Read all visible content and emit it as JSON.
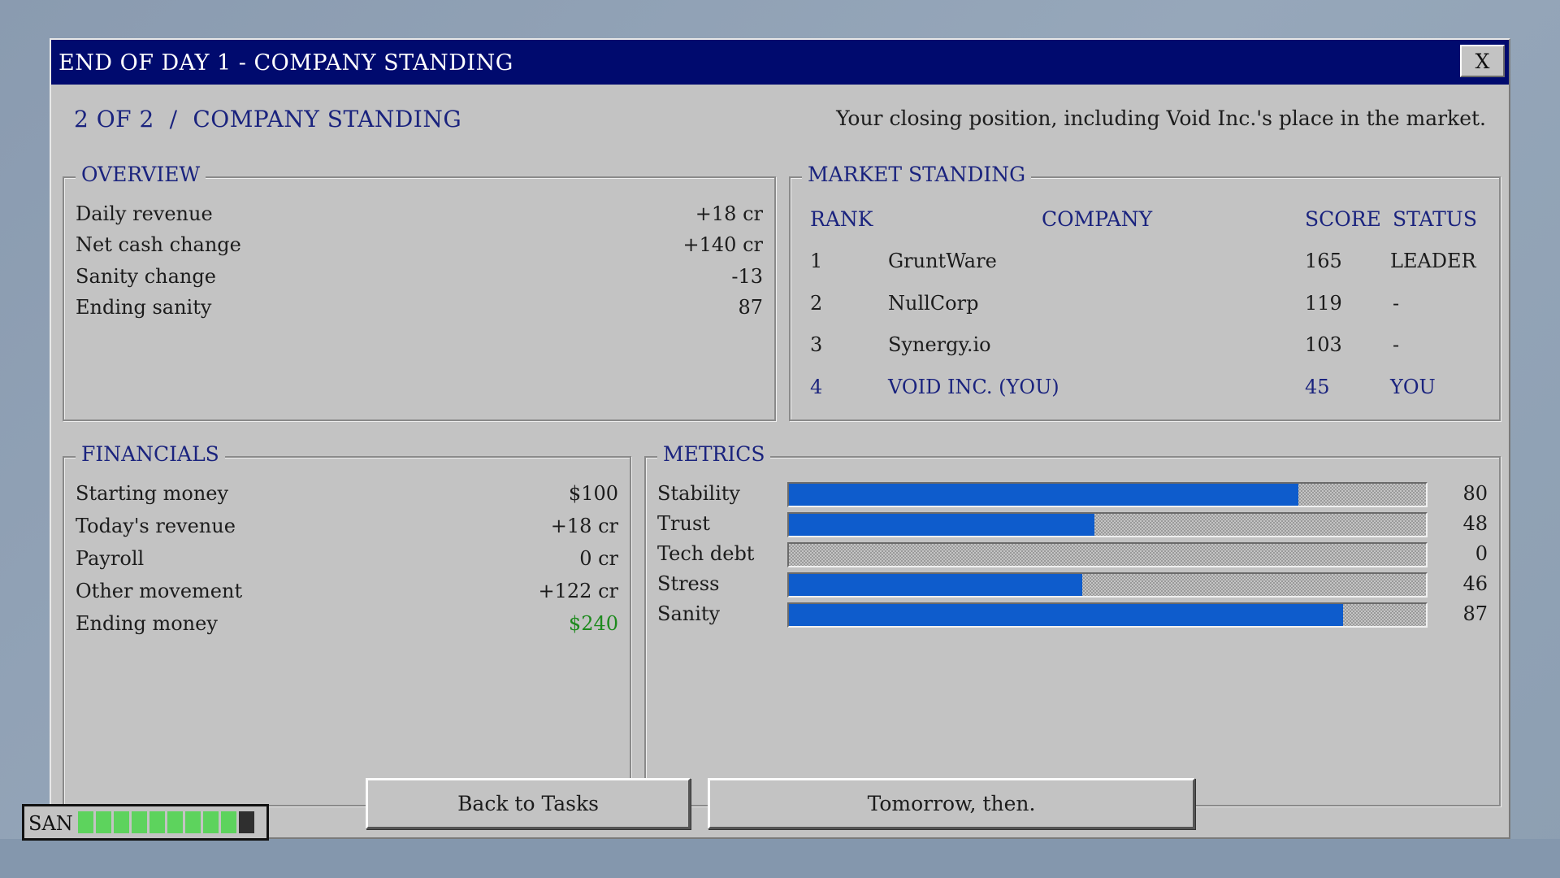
{
  "window": {
    "title": "END OF DAY 1 - COMPANY STANDING",
    "close_label": "X",
    "step": "2 OF 2  /  COMPANY STANDING",
    "subtitle": "Your closing position, including Void Inc.'s place in the market."
  },
  "overview": {
    "legend": "OVERVIEW",
    "rows": [
      {
        "label": "Daily revenue",
        "value": "+18 cr"
      },
      {
        "label": "Net cash change",
        "value": "+140 cr"
      },
      {
        "label": "Sanity change",
        "value": "-13"
      },
      {
        "label": "Ending sanity",
        "value": "87"
      }
    ]
  },
  "market": {
    "legend": "MARKET STANDING",
    "headers": {
      "rank": "RANK",
      "company": "COMPANY",
      "score": "SCORE",
      "status": "STATUS"
    },
    "rows": [
      {
        "rank": "1",
        "company": "GruntWare",
        "score": "165",
        "status": "LEADER"
      },
      {
        "rank": "2",
        "company": "NullCorp",
        "score": "119",
        "status": "-"
      },
      {
        "rank": "3",
        "company": "Synergy.io",
        "score": "103",
        "status": "-"
      },
      {
        "rank": "4",
        "company": "VOID INC. (YOU)",
        "score": "45",
        "status": "YOU"
      }
    ]
  },
  "financials": {
    "legend": "FINANCIALS",
    "rows": [
      {
        "label": "Starting money",
        "value": "$100"
      },
      {
        "label": "Today's revenue",
        "value": "+18 cr"
      },
      {
        "label": "Payroll",
        "value": "0 cr"
      },
      {
        "label": "Other movement",
        "value": "+122 cr"
      },
      {
        "label": "Ending money",
        "value": "$240"
      }
    ]
  },
  "metrics": {
    "legend": "METRICS",
    "bar_color": "#0e5ccc",
    "rows": [
      {
        "label": "Stability",
        "value": "80",
        "fill": 0.8
      },
      {
        "label": "Trust",
        "value": "48",
        "fill": 0.48
      },
      {
        "label": "Tech debt",
        "value": "0",
        "fill": 0.0
      },
      {
        "label": "Stress",
        "value": "46",
        "fill": 0.46
      },
      {
        "label": "Sanity",
        "value": "87",
        "fill": 0.87
      }
    ]
  },
  "buttons": {
    "back": "Back to Tasks",
    "next": "Tomorrow, then."
  },
  "san_meter": {
    "label": "SAN",
    "cells_total": 10,
    "cells_filled": 9,
    "fill_color": "#5dd35d"
  }
}
